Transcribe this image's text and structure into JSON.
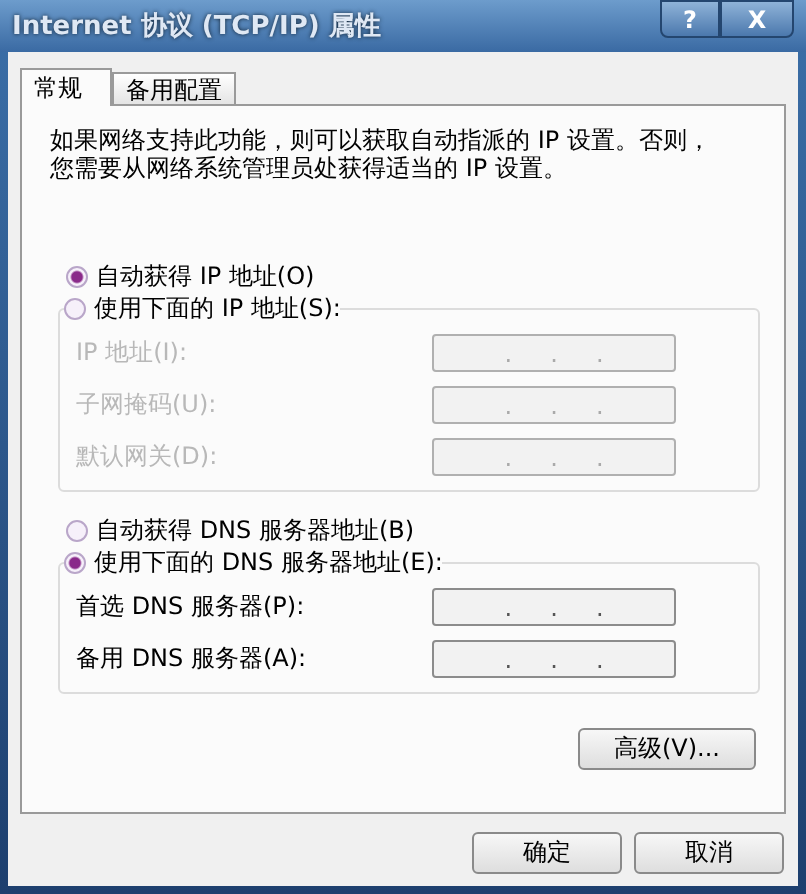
{
  "window": {
    "title": "Internet 协议 (TCP/IP) 属性",
    "help_button": "?",
    "close_button": "X"
  },
  "tabs": [
    {
      "label": "常规",
      "selected": true
    },
    {
      "label": "备用配置",
      "selected": false
    }
  ],
  "intro": [
    "如果网络支持此功能，则可以获取自动指派的 IP 设置。否则，",
    "您需要从网络系统管理员处获得适当的 IP 设置。"
  ],
  "sections": [
    {
      "auto_option": {
        "label": "自动获得 IP 地址(O)",
        "selected": true
      },
      "manual_group": {
        "option": {
          "label": "使用下面的 IP 地址(S):",
          "selected": false
        },
        "disabled": true,
        "fields": [
          {
            "label": "IP 地址(I):",
            "value": ".     .     ."
          },
          {
            "label": "子网掩码(U):",
            "value": ".     .     ."
          },
          {
            "label": "默认网关(D):",
            "value": ".     .     ."
          }
        ]
      }
    },
    {
      "auto_option": {
        "label": "自动获得 DNS 服务器地址(B)",
        "selected": false
      },
      "manual_group": {
        "option": {
          "label": "使用下面的 DNS 服务器地址(E):",
          "selected": true
        },
        "disabled": false,
        "fields": [
          {
            "label": "首选 DNS 服务器(P):",
            "value": ".     .     ."
          },
          {
            "label": "备用 DNS 服务器(A):",
            "value": ".     .     ."
          }
        ]
      }
    }
  ],
  "advanced_button": "高级(V)...",
  "buttons": [
    "确定",
    "取消"
  ]
}
